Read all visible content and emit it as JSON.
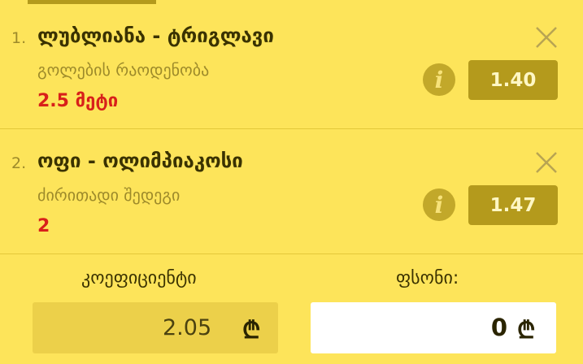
{
  "bets": [
    {
      "number": "1.",
      "title": "ლუბლიანა - ტრიგლავი",
      "market": "გოლების რაოდენობა",
      "pick": "2.5 მეტი",
      "odds": "1.40",
      "info_icon": "i"
    },
    {
      "number": "2.",
      "title": "ოფი - ოლიმპიაკოსი",
      "market": "ძირითადი შედეგი",
      "pick": "2",
      "odds": "1.47",
      "info_icon": "i"
    }
  ],
  "footer": {
    "coefficient_label": "კოეფიციენტი",
    "coefficient_value": "2.05",
    "stake_label": "ფსონი:",
    "stake_value": "0",
    "currency_symbol": "₾"
  },
  "colors": {
    "background": "#fde45a",
    "accent": "#b49a1c",
    "pick_red": "#d8201a"
  }
}
